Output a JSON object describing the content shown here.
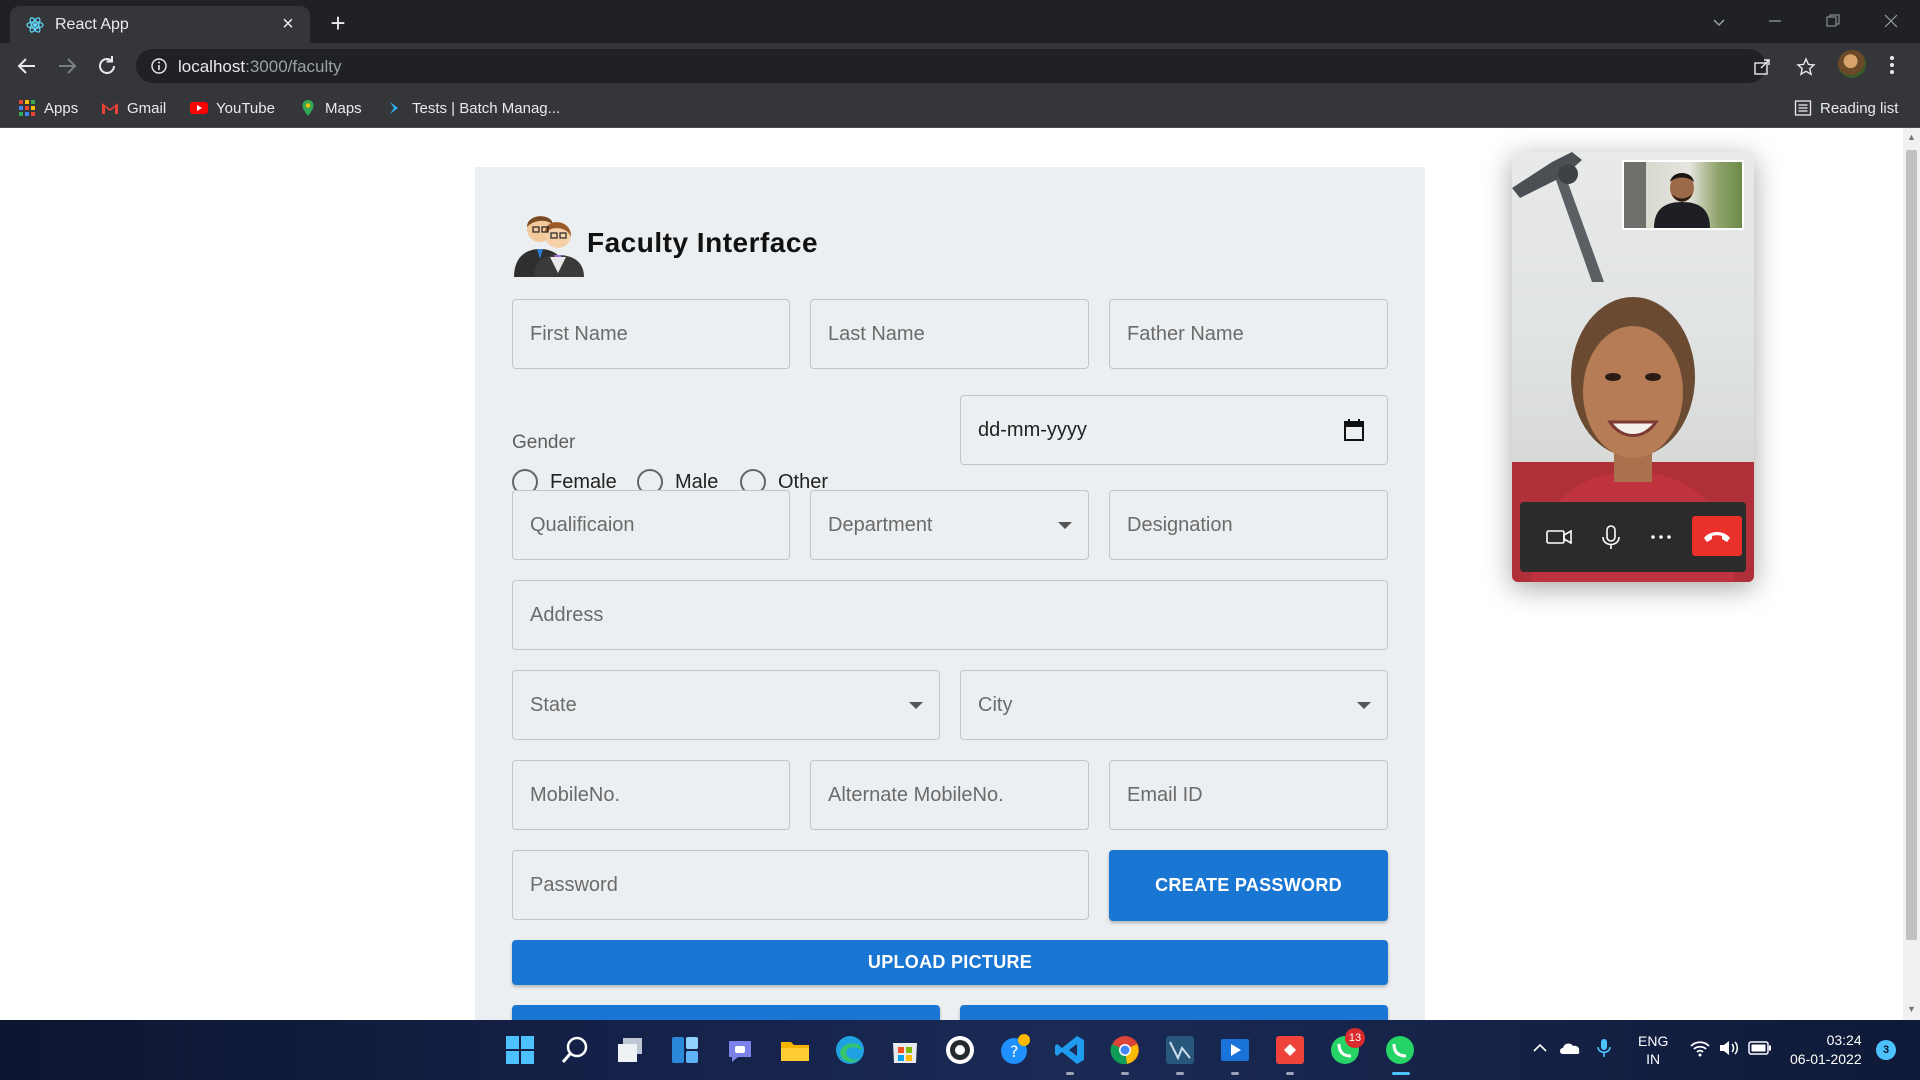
{
  "browser": {
    "tab_title": "React App",
    "url_host": "localhost",
    "url_path": ":3000/faculty",
    "bookmarks": [
      "Apps",
      "Gmail",
      "YouTube",
      "Maps",
      "Tests | Batch Manag..."
    ],
    "reading_list": "Reading list"
  },
  "form": {
    "title": "Faculty Interface",
    "first_name": "First Name",
    "last_name": "Last Name",
    "father_name": "Father Name",
    "gender_label": "Gender",
    "gender_options": [
      "Female",
      "Male",
      "Other"
    ],
    "dob_placeholder": "dd-mm-yyyy",
    "qualification": "Qualificaion",
    "department": "Department",
    "designation": "Designation",
    "address": "Address",
    "state": "State",
    "city": "City",
    "mobile": "MobileNo.",
    "alt_mobile": "Alternate MobileNo.",
    "email": "Email ID",
    "password": "Password",
    "create_password_button": "CREATE PASSWORD",
    "upload_picture_button": "UPLOAD PICTURE"
  },
  "taskbar": {
    "language": "ENG",
    "region": "IN",
    "time": "03:24",
    "date": "06-01-2022",
    "notification_count": "3",
    "teams_badge": "13"
  },
  "colors": {
    "primary": "#1976d2",
    "card_bg": "#eceff1",
    "end_call": "#e9302b"
  }
}
